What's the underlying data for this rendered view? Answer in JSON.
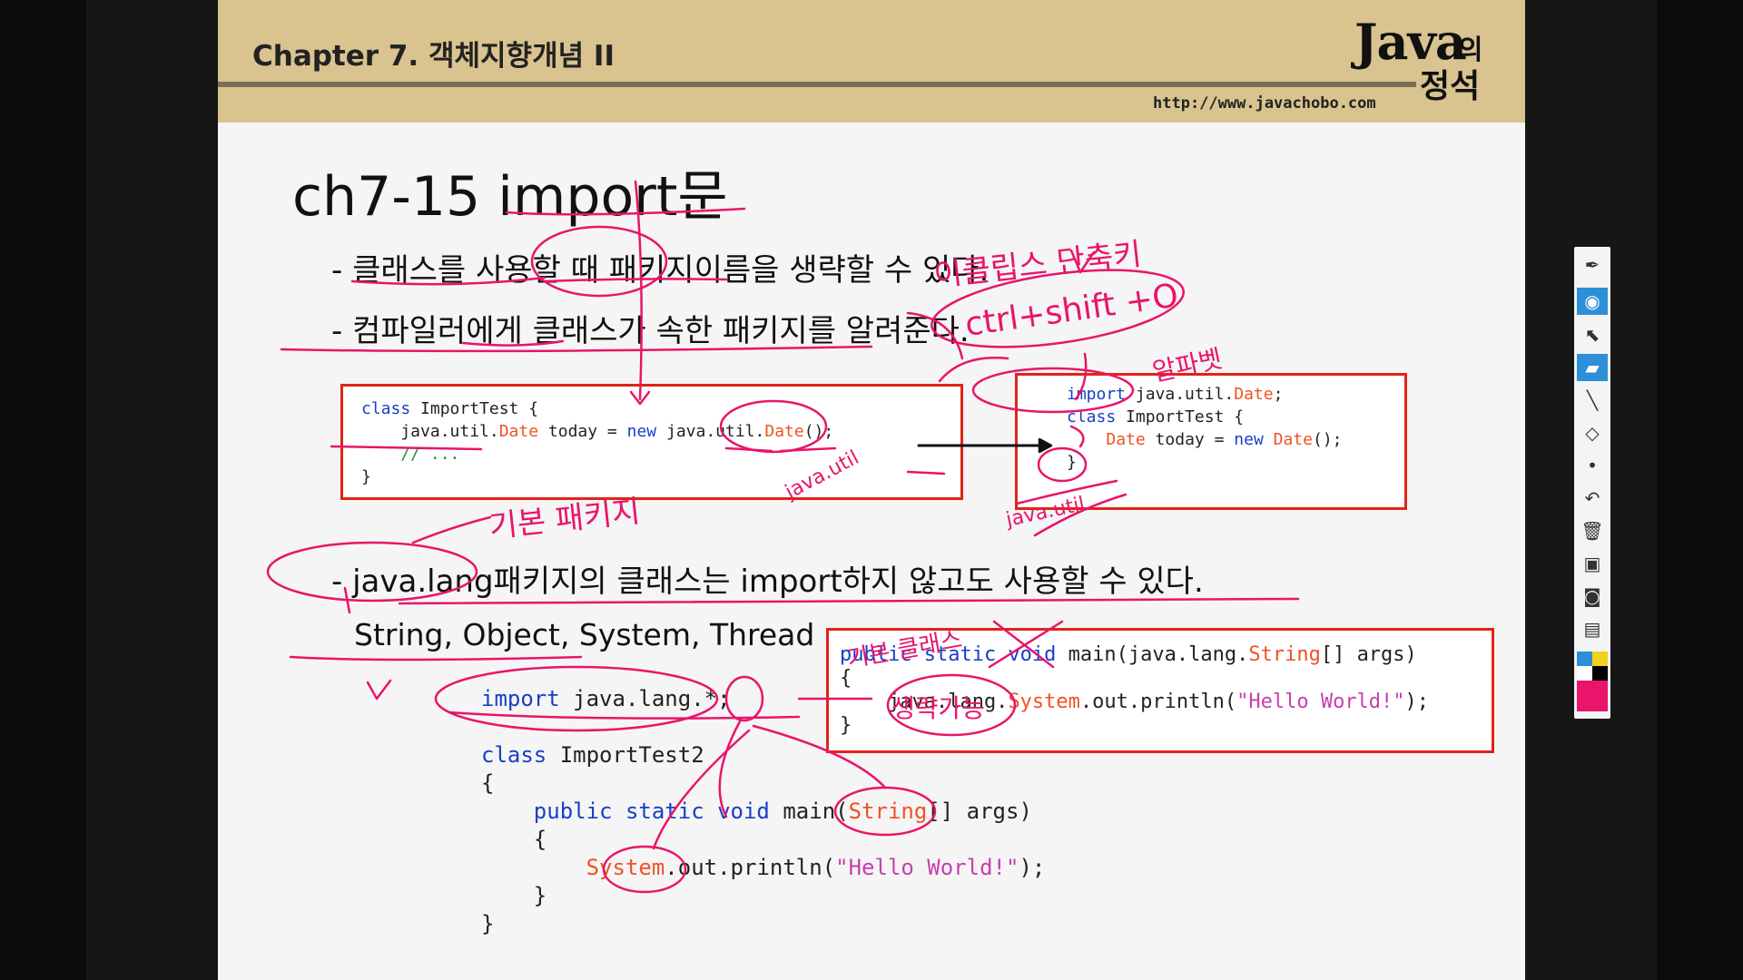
{
  "header": {
    "chapter": "Chapter 7. 객체지향개념 II",
    "url": "http://www.javachobo.com",
    "logo_java": "Java",
    "logo_ui": "의",
    "logo_jeong": "정석"
  },
  "slide": {
    "title": "ch7-15 import문",
    "bullet1": "- 클래스를 사용할 때 패키지이름을 생략할 수 있다.",
    "bullet2": "- 컴파일러에게 클래스가 속한 패키지를 알려준다.",
    "bullet3": "- java.lang패키지의 클래스는 import하지 않고도 사용할 수 있다.",
    "examples": "String, Object, System, Thread ..."
  },
  "code1": {
    "l1_kw": "class",
    "l1_rest": " ImportTest {",
    "l2_pre": "    java.util.",
    "l2_type": "Date",
    "l2_mid": " today = ",
    "l2_new": "new",
    "l2_pkg": " java.util.",
    "l2_type2": "Date",
    "l2_end": "();",
    "l3": "    // ...",
    "l4": "}"
  },
  "code2": {
    "l1_kw": "import",
    "l1_pkg": " java.util.",
    "l1_type": "Date",
    "l1_end": ";",
    "l2_kw": "class",
    "l2_rest": " ImportTest {",
    "l3_pre": "    ",
    "l3_type": "Date",
    "l3_mid": " today = ",
    "l3_new": "new",
    "l3_sp": " ",
    "l3_type2": "Date",
    "l3_end": "();",
    "l4": "}"
  },
  "code3": {
    "l1_kw": "public static void",
    "l1_mid": " main(java.lang.",
    "l1_type": "String",
    "l1_end": "[] args)",
    "l2": "{",
    "l3_pre": "    java.lang.",
    "l3_type": "System",
    "l3_mid": ".out.println(",
    "l3_str": "\"Hello World!\"",
    "l3_end": ");",
    "l4": "}"
  },
  "code4": {
    "l1_kw": "import",
    "l1_rest": " java.lang.*;",
    "l2_kw": "class",
    "l2_rest": " ImportTest2",
    "l3": "{",
    "l4_pre": "    ",
    "l4_kw": "public static void",
    "l4_mid": " main(",
    "l4_type": "String",
    "l4_end": "[] args)",
    "l5": "    {",
    "l6_pre": "        ",
    "l6_type": "System",
    "l6_mid": ".out.println(",
    "l6_str": "\"Hello World!\"",
    "l6_end": ");",
    "l7": "    }",
    "l8": "}"
  },
  "annotations": {
    "eclipse": "이클립스 단축키",
    "shortcut": "ctrl+shift +O",
    "memo": "알파벳",
    "basic_pkg": "기본 패키지",
    "basic_class": "기본 클래스",
    "omit": "생략가능",
    "java_util_left": "java.util",
    "java_util_bottom": "java.util"
  },
  "colors": {
    "header_bg": "#d9c38f",
    "rule": "#7c6d58",
    "keyword": "#1a3ec8",
    "type": "#ef5224",
    "string": "#c83fb0",
    "box_border": "#e02418",
    "ink": "#e8156a",
    "toolbar_active": "#2c8fd8"
  },
  "toolbar": {
    "pen": "✒",
    "eye": "◉",
    "pointer": "⬉",
    "highlighter": "▰",
    "line": "╲",
    "eraser": "◇",
    "dot": "•",
    "undo": "↶",
    "trash": "🗑",
    "screen": "▣",
    "camera": "◙",
    "clipboard": "▤"
  }
}
